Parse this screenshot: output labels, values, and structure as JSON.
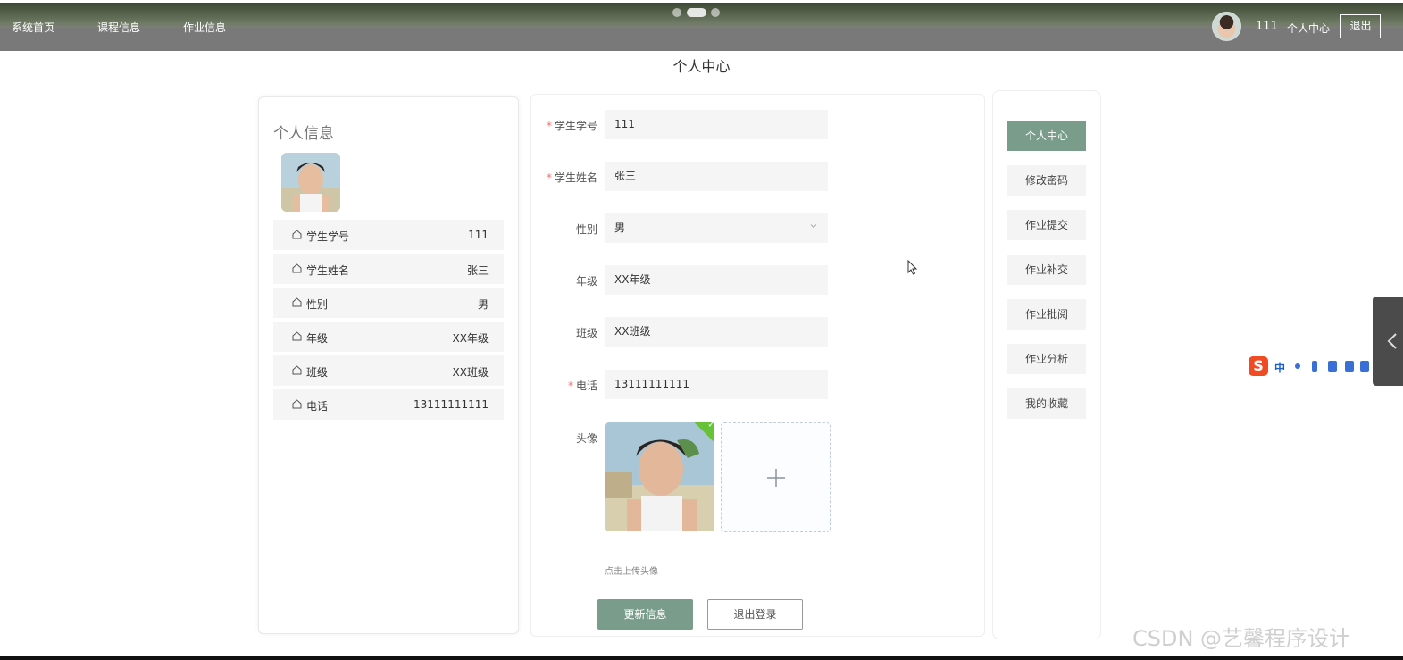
{
  "nav": {
    "items": [
      {
        "label": "系统首页"
      },
      {
        "label": "课程信息"
      },
      {
        "label": "作业信息"
      }
    ],
    "username": "111",
    "center_label": "个人中心",
    "logout_label": "退出"
  },
  "page_title": "个人中心",
  "profile_card": {
    "title": "个人信息",
    "rows": [
      {
        "label": "学生学号",
        "value": "111"
      },
      {
        "label": "学生姓名",
        "value": "张三"
      },
      {
        "label": "性别",
        "value": "男"
      },
      {
        "label": "年级",
        "value": "XX年级"
      },
      {
        "label": "班级",
        "value": "XX班级"
      },
      {
        "label": "电话",
        "value": "13111111111"
      }
    ]
  },
  "form": {
    "student_no": {
      "label": "学生学号",
      "value": "111",
      "required": true
    },
    "student_name": {
      "label": "学生姓名",
      "value": "张三",
      "required": true
    },
    "gender": {
      "label": "性别",
      "value": "男"
    },
    "grade": {
      "label": "年级",
      "value": "XX年级"
    },
    "class": {
      "label": "班级",
      "value": "XX班级"
    },
    "phone": {
      "label": "电话",
      "value": "13111111111",
      "required": true
    },
    "avatar": {
      "label": "头像",
      "tip": "点击上传头像"
    },
    "update_button": "更新信息",
    "logout_button": "退出登录"
  },
  "side_menu": {
    "items": [
      {
        "label": "个人中心",
        "active": true
      },
      {
        "label": "修改密码"
      },
      {
        "label": "作业提交"
      },
      {
        "label": "作业补交"
      },
      {
        "label": "作业批阅"
      },
      {
        "label": "作业分析"
      },
      {
        "label": "我的收藏"
      }
    ]
  },
  "ime": {
    "logo": "S",
    "mode": "中"
  },
  "watermark": "CSDN @艺馨程序设计",
  "colors": {
    "accent": "#7a9d8b",
    "required": "#f56c6c"
  }
}
